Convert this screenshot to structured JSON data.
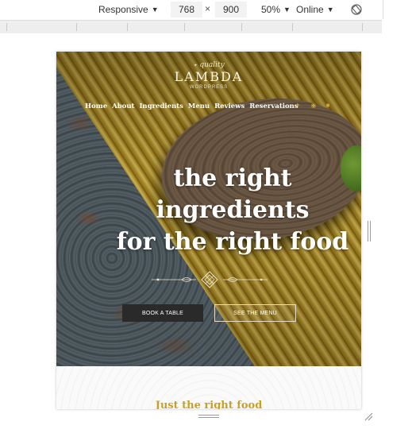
{
  "devtools": {
    "device_mode": "Responsive",
    "width": "768",
    "dim_separator": "×",
    "height": "900",
    "zoom": "50%",
    "network": "Online",
    "rotate_icon": "rotate-icon",
    "caret": "▼"
  },
  "site": {
    "logo": {
      "top": "quality",
      "main": "LAMBDA",
      "sub": "WORDPRESS"
    },
    "nav": {
      "items": [
        "Home",
        "About",
        "Ingredients",
        "Menu",
        "Reviews",
        "Reservations"
      ],
      "social_icons": [
        "twitter-icon",
        "instagram-icon",
        "tripadvisor-icon"
      ]
    },
    "hero": {
      "headline_line1": "the right",
      "headline_line2": "ingredients",
      "headline_line3": "for the right food",
      "book_button": "BOOK A TABLE",
      "menu_button": "SEE THE MENU"
    },
    "section": {
      "tagline": "Just the right food"
    }
  },
  "colors": {
    "accent_gold": "#c9a020",
    "button_dark": "#2a2a2a"
  }
}
